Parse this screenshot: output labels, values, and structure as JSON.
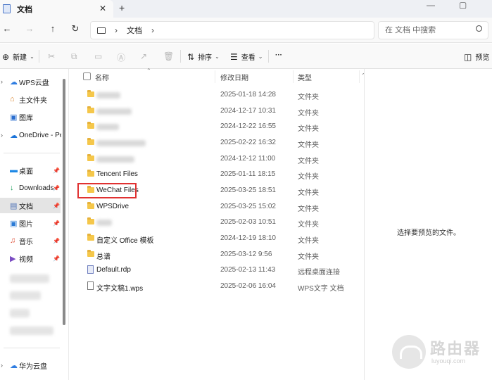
{
  "window": {
    "tab_title": "文档",
    "close_tab": "✕",
    "new_tab": "+",
    "minimize": "—",
    "maximize": "▢"
  },
  "nav": {
    "back": "←",
    "forward": "→",
    "up": "↑",
    "refresh": "↻",
    "breadcrumb_sep": "›",
    "breadcrumb": "文档",
    "breadcrumb_end": "›",
    "search_placeholder": "在 文档 中搜索"
  },
  "toolbar": {
    "new_label": "新建",
    "sort_label": "排序",
    "view_label": "查看",
    "more_label": "···",
    "preview_label": "预览"
  },
  "sidebar": {
    "items": [
      {
        "label": "WPS云盘",
        "icon": "cloud-icon"
      },
      {
        "label": "主文件夹",
        "icon": "home-icon"
      },
      {
        "label": "图库",
        "icon": "gallery-icon"
      },
      {
        "label": "OneDrive - Per",
        "icon": "onedrive-icon"
      },
      {
        "label": "桌面",
        "icon": "desktop-icon"
      },
      {
        "label": "Downloads",
        "icon": "download-icon"
      },
      {
        "label": "文档",
        "icon": "documents-icon"
      },
      {
        "label": "图片",
        "icon": "pictures-icon"
      },
      {
        "label": "音乐",
        "icon": "music-icon"
      },
      {
        "label": "视频",
        "icon": "video-icon"
      },
      {
        "label": "华为云盘",
        "icon": "cloud-icon"
      }
    ]
  },
  "columns": {
    "name": "名称",
    "modified": "修改日期",
    "type": "类型"
  },
  "files": [
    {
      "name": "",
      "date": "2025-01-18 14:28",
      "type": "文件夹"
    },
    {
      "name": "",
      "date": "2024-12-17 10:31",
      "type": "文件夹"
    },
    {
      "name": "",
      "date": "2024-12-22 16:55",
      "type": "文件夹"
    },
    {
      "name": "",
      "date": "2025-02-22 16:32",
      "type": "文件夹"
    },
    {
      "name": "",
      "date": "2024-12-12 11:00",
      "type": "文件夹"
    },
    {
      "name": "Tencent Files",
      "date": "2025-01-11 18:15",
      "type": "文件夹"
    },
    {
      "name": "WeChat Files",
      "date": "2025-03-25 18:51",
      "type": "文件夹"
    },
    {
      "name": "WPSDrive",
      "date": "2025-03-25 15:02",
      "type": "文件夹"
    },
    {
      "name": "",
      "date": "2025-02-03 10:51",
      "type": "文件夹"
    },
    {
      "name": "自定义 Office 模板",
      "date": "2024-12-19 18:10",
      "type": "文件夹"
    },
    {
      "name": "总谱",
      "date": "2025-03-12 9:56",
      "type": "文件夹"
    },
    {
      "name": "Default.rdp",
      "date": "2025-02-13 11:43",
      "type": "远程桌面连接"
    },
    {
      "name": "文字文稿1.wps",
      "date": "2025-02-06 16:04",
      "type": "WPS文字 文档"
    }
  ],
  "preview": {
    "empty_text": "选择要预览的文件。"
  },
  "watermark": {
    "title": "路由器",
    "subtitle": "luyouqi.com"
  }
}
